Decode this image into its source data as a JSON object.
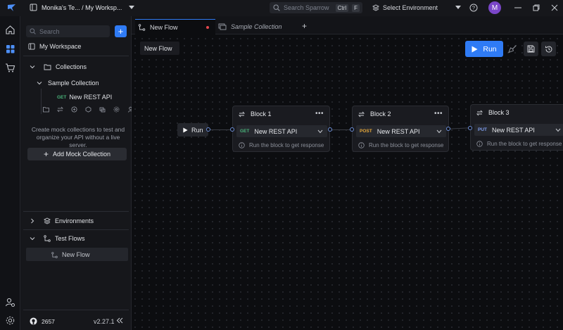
{
  "titlebar": {
    "workspace_label": "Monika's Te... / My Worksp...",
    "search_placeholder": "Search Sparrow",
    "kbd_ctrl": "Ctrl",
    "kbd_f": "F",
    "environment_label": "Select Environment",
    "avatar_initial": "M"
  },
  "sidebar": {
    "search_placeholder": "Search",
    "add_label": "+",
    "workspace_name": "My Workspace",
    "collections_label": "Collections",
    "collection_name": "Sample Collection",
    "request": {
      "method": "GET",
      "name": "New REST API"
    },
    "empty_text": "Create mock collections to test and organize your API without a live server.",
    "mock_button_label": "Add Mock Collection",
    "environments_label": "Environments",
    "test_flows_label": "Test Flows",
    "flow_item": "New Flow",
    "github_stars": "2657",
    "version": "v2.27.1"
  },
  "tabs": [
    {
      "label": "New Flow"
    },
    {
      "label": "Sample Collection"
    }
  ],
  "tab_add_label": "+",
  "canvas": {
    "flow_name": "New Flow",
    "run_label": "Run",
    "start_node_label": "Run",
    "blocks": [
      {
        "title": "Block 1",
        "method": "GET",
        "request": "New REST API",
        "info": "Run the block to get response"
      },
      {
        "title": "Block 2",
        "method": "POST",
        "request": "New REST API",
        "info": "Run the block to get response"
      },
      {
        "title": "Block 3",
        "method": "PUT",
        "request": "New REST API",
        "info": "Run the block to get response"
      }
    ]
  },
  "colors": {
    "accent": "#2f7bf5",
    "get": "#49b37a",
    "post": "#e8a93a",
    "put": "#7f9ef0",
    "unsaved_dot": "#e5484d"
  }
}
